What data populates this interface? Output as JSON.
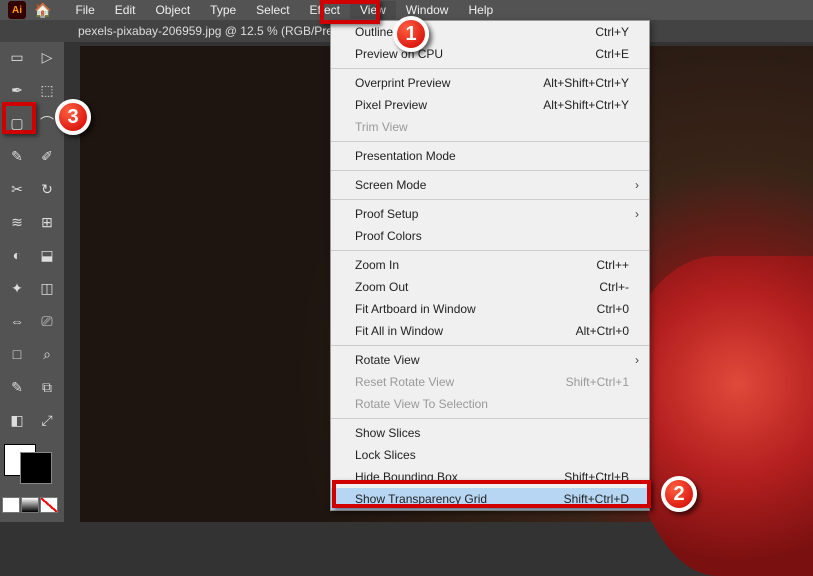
{
  "app": {
    "abbrev": "Ai"
  },
  "menubar": {
    "items": [
      "File",
      "Edit",
      "Object",
      "Type",
      "Select",
      "Effect",
      "View",
      "Window",
      "Help"
    ],
    "active_index": 6
  },
  "document_tab": "pexels-pixabay-206959.jpg @ 12.5 % (RGB/Preview)",
  "tools_left_column": [
    "▭",
    "✒",
    "▢",
    "✎",
    "✂",
    "≋",
    "◐",
    "✦",
    "⇔",
    "□",
    "✎",
    "◧"
  ],
  "tools_right_column": [
    "▷",
    "⬚",
    "⌒",
    "✐",
    "↻",
    "⊞",
    "⬓",
    "◫",
    "⎚",
    "⌕",
    "⧉",
    "⤢"
  ],
  "view_menu": {
    "groups": [
      [
        {
          "label": "Outline",
          "shortcut": "Ctrl+Y",
          "enabled": true
        },
        {
          "label": "Preview on CPU",
          "shortcut": "Ctrl+E",
          "enabled": true
        }
      ],
      [
        {
          "label": "Overprint Preview",
          "shortcut": "Alt+Shift+Ctrl+Y",
          "enabled": true
        },
        {
          "label": "Pixel Preview",
          "shortcut": "Alt+Shift+Ctrl+Y",
          "enabled": true
        },
        {
          "label": "Trim View",
          "shortcut": "",
          "enabled": false
        }
      ],
      [
        {
          "label": "Presentation Mode",
          "shortcut": "",
          "enabled": true
        }
      ],
      [
        {
          "label": "Screen Mode",
          "shortcut": "",
          "enabled": true,
          "submenu": true
        }
      ],
      [
        {
          "label": "Proof Setup",
          "shortcut": "",
          "enabled": true,
          "submenu": true
        },
        {
          "label": "Proof Colors",
          "shortcut": "",
          "enabled": true
        }
      ],
      [
        {
          "label": "Zoom In",
          "shortcut": "Ctrl++",
          "enabled": true
        },
        {
          "label": "Zoom Out",
          "shortcut": "Ctrl+-",
          "enabled": true
        },
        {
          "label": "Fit Artboard in Window",
          "shortcut": "Ctrl+0",
          "enabled": true
        },
        {
          "label": "Fit All in Window",
          "shortcut": "Alt+Ctrl+0",
          "enabled": true
        }
      ],
      [
        {
          "label": "Rotate View",
          "shortcut": "",
          "enabled": true,
          "submenu": true
        },
        {
          "label": "Reset Rotate View",
          "shortcut": "Shift+Ctrl+1",
          "enabled": false
        },
        {
          "label": "Rotate View To Selection",
          "shortcut": "",
          "enabled": false
        }
      ],
      [
        {
          "label": "Show Slices",
          "shortcut": "",
          "enabled": true
        },
        {
          "label": "Lock Slices",
          "shortcut": "",
          "enabled": true
        },
        {
          "label": "Hide Bounding Box",
          "shortcut": "Shift+Ctrl+B",
          "enabled": true
        },
        {
          "label": "Show Transparency Grid",
          "shortcut": "Shift+Ctrl+D",
          "enabled": true,
          "highlighted": true
        }
      ]
    ]
  },
  "callouts": {
    "c1": "1",
    "c2": "2",
    "c3": "3"
  }
}
